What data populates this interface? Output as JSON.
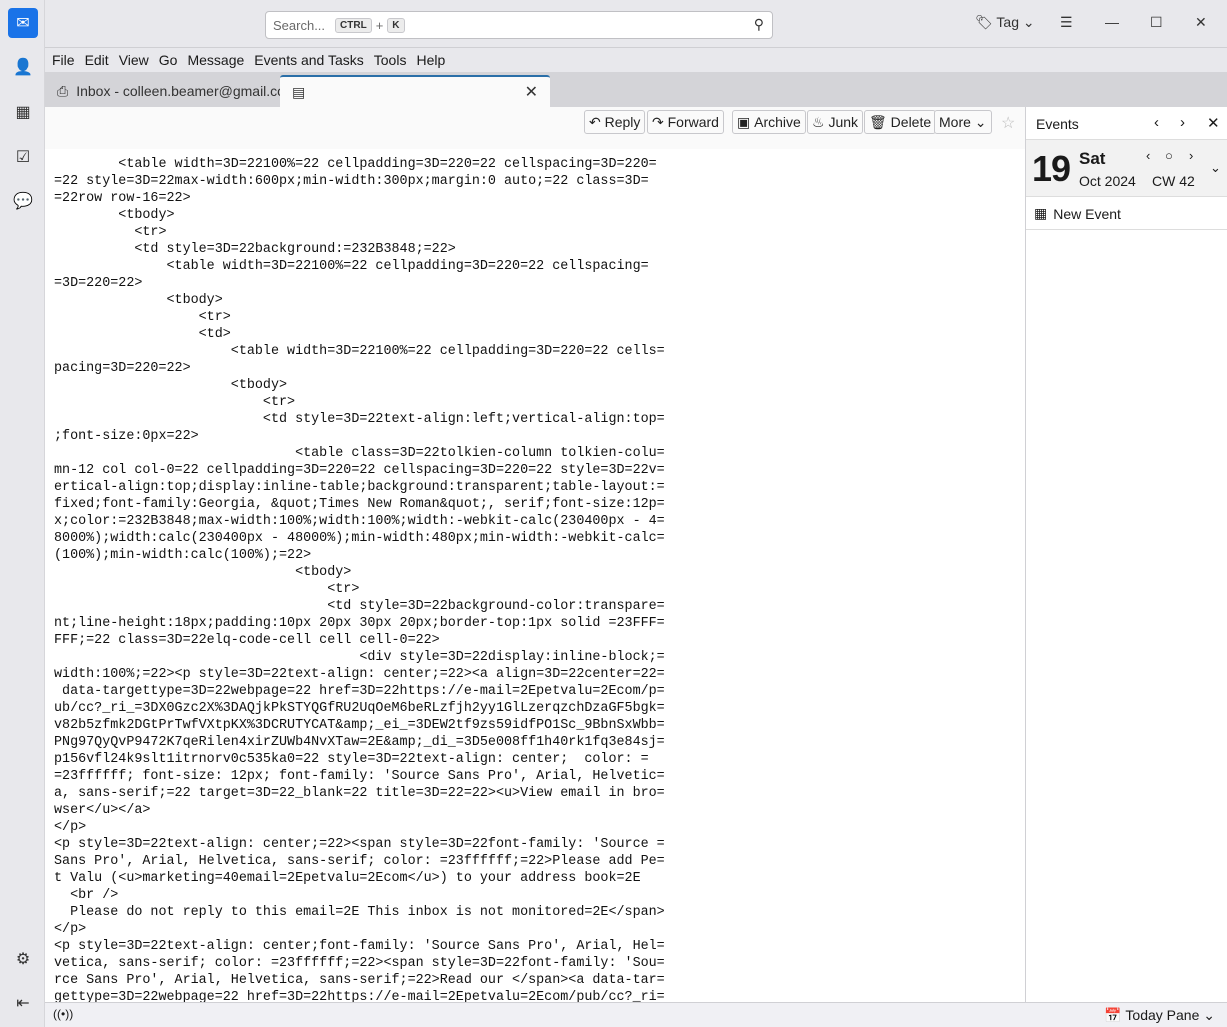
{
  "search": {
    "placeholder": "Search...",
    "kbd_ctrl": "CTRL",
    "kbd_plus": "+",
    "kbd_k": "K"
  },
  "topbar": {
    "tag_label": "Tag"
  },
  "menu": [
    "File",
    "Edit",
    "View",
    "Go",
    "Message",
    "Events and Tasks",
    "Tools",
    "Help"
  ],
  "tabs": [
    {
      "label": "Inbox - colleen.beamer@gmail.com"
    },
    {
      "label": ""
    }
  ],
  "toolbar": {
    "reply": "Reply",
    "forward": "Forward",
    "archive": "Archive",
    "junk": "Junk",
    "delete": "Delete",
    "more": "More"
  },
  "events": {
    "title": "Events",
    "day_number": "19",
    "weekday": "Sat",
    "month_year": "Oct 2024",
    "week": "CW 42",
    "new_event": "New Event"
  },
  "status": {
    "today_pane": "Today Pane"
  },
  "source_lines": [
    "        <table width=3D=22100%=22 cellpadding=3D=220=22 cellspacing=3D=220=",
    "=22 style=3D=22max-width:600px;min-width:300px;margin:0 auto;=22 class=3D=",
    "=22row row-16=22>",
    "        <tbody>",
    "          <tr>",
    "          <td style=3D=22background:=232B3848;=22>",
    "              <table width=3D=22100%=22 cellpadding=3D=220=22 cellspacing=",
    "=3D=220=22>",
    "              <tbody>",
    "                  <tr>",
    "                  <td>",
    "                      <table width=3D=22100%=22 cellpadding=3D=220=22 cells=",
    "pacing=3D=220=22>",
    "                      <tbody>",
    "                          <tr>",
    "                          <td style=3D=22text-align:left;vertical-align:top=",
    ";font-size:0px=22>",
    "                              <table class=3D=22tolkien-column tolkien-colu=",
    "mn-12 col col-0=22 cellpadding=3D=220=22 cellspacing=3D=220=22 style=3D=22v=",
    "ertical-align:top;display:inline-table;background:transparent;table-layout:=",
    "fixed;font-family:Georgia, &quot;Times New Roman&quot;, serif;font-size:12p=",
    "x;color:=232B3848;max-width:100%;width:100%;width:-webkit-calc(230400px - 4=",
    "8000%);width:calc(230400px - 48000%);min-width:480px;min-width:-webkit-calc=",
    "(100%);min-width:calc(100%);=22>",
    "                              <tbody>",
    "                                  <tr>",
    "                                  <td style=3D=22background-color:transpare=",
    "nt;line-height:18px;padding:10px 20px 30px 20px;border-top:1px solid =23FFF=",
    "FFF;=22 class=3D=22elq-code-cell cell cell-0=22>",
    "                                      <div style=3D=22display:inline-block;=",
    "width:100%;=22><p style=3D=22text-align: center;=22><a align=3D=22center=22=",
    " data-targettype=3D=22webpage=22 href=3D=22https://e-mail=2Epetvalu=2Ecom/p=",
    "ub/cc?_ri_=3DX0Gzc2X%3DAQjkPkSTYQGfRU2UqOeM6beRLzfjh2yy1GlLzerqzchDzaGF5bgk=",
    "v82b5zfmk2DGtPrTwfVXtpKX%3DCRUTYCAT&amp;_ei_=3DEW2tf9zs59idfPO1Sc_9BbnSxWbb=",
    "PNg97QyQvP9472K7qeRilen4xirZUWb4NvXTaw=2E&amp;_di_=3D5e008ff1h40rk1fq3e84sj=",
    "p156vfl24k9slt1itrnorv0c535ka0=22 style=3D=22text-align: center;  color: =",
    "=23ffffff; font-size: 12px; font-family: 'Source Sans Pro', Arial, Helvetic=",
    "a, sans-serif;=22 target=3D=22_blank=22 title=3D=22=22><u>View email in bro=",
    "wser</u></a>",
    "</p>",
    "<p style=3D=22text-align: center;=22><span style=3D=22font-family: 'Source =",
    "Sans Pro', Arial, Helvetica, sans-serif; color: =23ffffff;=22>Please add Pe=",
    "t Valu (<u>marketing=40email=2Epetvalu=2Ecom</u>) to your address book=2E",
    "  <br />",
    "  Please do not reply to this email=2E This inbox is not monitored=2E</span>",
    "</p>",
    "<p style=3D=22text-align: center;font-family: 'Source Sans Pro', Arial, Hel=",
    "vetica, sans-serif; color: =23ffffff;=22><span style=3D=22font-family: 'Sou=",
    "rce Sans Pro', Arial, Helvetica, sans-serif;=22>Read our </span><a data-tar=",
    "gettype=3D=22webpage=22 href=3D=22https://e-mail=2Epetvalu=2Ecom/pub/cc?_ri="
  ]
}
